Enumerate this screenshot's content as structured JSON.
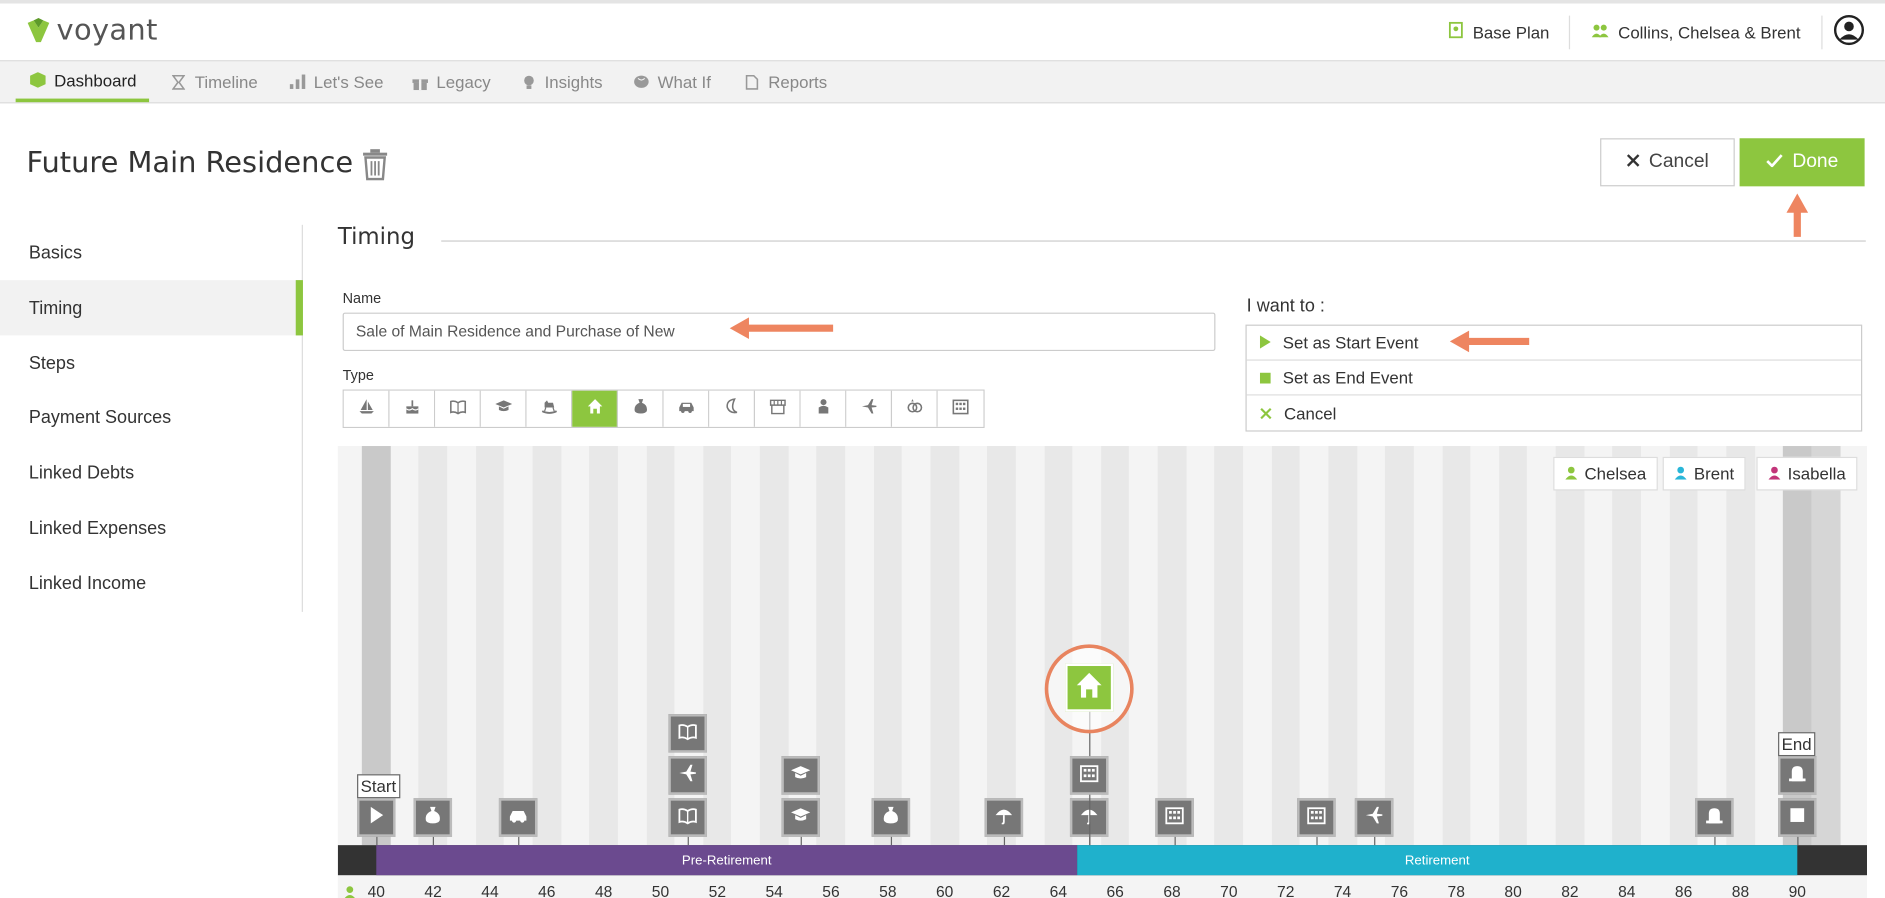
{
  "header": {
    "logo_text": "voyant",
    "plan_label": "Base Plan",
    "client_label": "Collins, Chelsea & Brent"
  },
  "nav": {
    "items": [
      {
        "label": "Dashboard",
        "icon": "cube-icon"
      },
      {
        "label": "Timeline",
        "icon": "hourglass-icon"
      },
      {
        "label": "Let's See",
        "icon": "bar-chart-icon"
      },
      {
        "label": "Legacy",
        "icon": "gift-icon"
      },
      {
        "label": "Insights",
        "icon": "lightbulb-icon"
      },
      {
        "label": "What If",
        "icon": "brain-icon"
      },
      {
        "label": "Reports",
        "icon": "pdf-icon"
      }
    ],
    "active": "Dashboard"
  },
  "page": {
    "title": "Future Main Residence",
    "cancel_label": "Cancel",
    "done_label": "Done"
  },
  "sidebar": {
    "items": [
      "Basics",
      "Timing",
      "Steps",
      "Payment Sources",
      "Linked Debts",
      "Linked Expenses",
      "Linked Income"
    ],
    "active": "Timing"
  },
  "section": {
    "title": "Timing"
  },
  "form": {
    "name_label": "Name",
    "name_value": "Sale of Main Residence and Purchase of New",
    "type_label": "Type",
    "types": [
      "boat-icon",
      "cake-icon",
      "book-icon",
      "graduation-cap-icon",
      "rocking-horse-icon",
      "house-icon",
      "money-bag-icon",
      "car-icon",
      "moon-icon",
      "store-icon",
      "person-icon",
      "plane-icon",
      "rings-icon",
      "building-icon"
    ],
    "selected_type": "house-icon"
  },
  "iwant": {
    "label": "I want to :",
    "options": [
      "Set as Start Event",
      "Set as End Event",
      "Cancel"
    ]
  },
  "timeline": {
    "members": [
      {
        "name": "Chelsea",
        "color": "#8dc63f"
      },
      {
        "name": "Brent",
        "color": "#29b6d8"
      },
      {
        "name": "Isabella",
        "color": "#c2357a"
      }
    ],
    "start_flag": "Start",
    "end_flag": "End",
    "phases": [
      {
        "label": "Pre-Retirement",
        "color": "#6b4a8f"
      },
      {
        "label": "Retirement",
        "color": "#1fb1cc"
      }
    ],
    "ages": [
      "40",
      "42",
      "44",
      "46",
      "48",
      "50",
      "52",
      "54",
      "56",
      "58",
      "60",
      "62",
      "64",
      "66",
      "68",
      "70",
      "72",
      "74",
      "76",
      "78",
      "80",
      "82",
      "84",
      "86",
      "88",
      "90"
    ]
  },
  "colors": {
    "accent": "#8dc63f",
    "highlight_ring": "#e8845f"
  }
}
